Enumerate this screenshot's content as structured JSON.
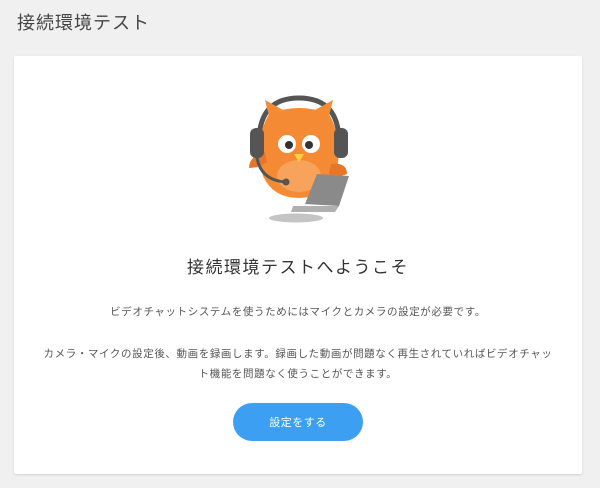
{
  "header": {
    "title": "接続環境テスト"
  },
  "welcome": {
    "mascot": "owl-with-headset-and-laptop",
    "title": "接続環境テストへようこそ",
    "description_1": "ビデオチャットシステムを使うためにはマイクとカメラの設定が必要です。",
    "description_2": "カメラ・マイクの設定後、動画を録画します。録画した動画が問題なく再生されていればビデオチャット機能を問題なく使うことができます。",
    "button_label": "設定をする"
  },
  "colors": {
    "background": "#f0f0f0",
    "card": "#ffffff",
    "accent": "#3d9ff2",
    "mascot_orange": "#f58a35",
    "headset_gray": "#555555"
  }
}
